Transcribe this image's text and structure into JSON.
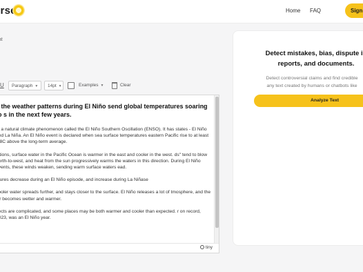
{
  "header": {
    "logo_text": "erse",
    "nav": {
      "home": "Home",
      "faq": "FAQ"
    },
    "signup_label": "Sign u"
  },
  "left": {
    "card_label": "nat",
    "toolbar": {
      "underline": "U",
      "paragraph": "Paragraph",
      "font_size": "14pt",
      "examples": "Examples",
      "clear": "Clear"
    },
    "editor": {
      "heading": "y the weather patterns during El Niño send global temperatures soaring to s in the next few years.",
      "paragraphs": [
        "of a natural climate phenomenon called the El Niño Southern Oscillation (ENSO). It has states - El Niño and La Niña. An El Niño event is declared when sea surface temperatures eastern Pacific rise to at least 0.8C above the long-term average.",
        "ditions, surface water in the Pacific Ocean is warmer in the east and cooler in the west. ds\" tend to blow north-to-west, and heat from the sun progressively warms the waters in this direction. During El Niño events, these winds weaken, sending warm surface waters ead.",
        "atures decrease during an El Niño episode, and increase during La Niñase",
        "cooler water spreads further, and stays closer to the surface. El Niño releases a lot of tmosphere, and the air becomes wetter and warmer.",
        "ffects are complicated, and some places may be both warmer and cooler than expected. r on record, 2023, was an El Niño year."
      ]
    },
    "status": {
      "brand": "tiny"
    }
  },
  "right": {
    "title": "Detect mistakes, bias, dispute in reports, and documents.",
    "subtitle": "Detect controversial claims and find credible any text created by humans or chatbots like",
    "analyze_label": "Analyze Text"
  }
}
